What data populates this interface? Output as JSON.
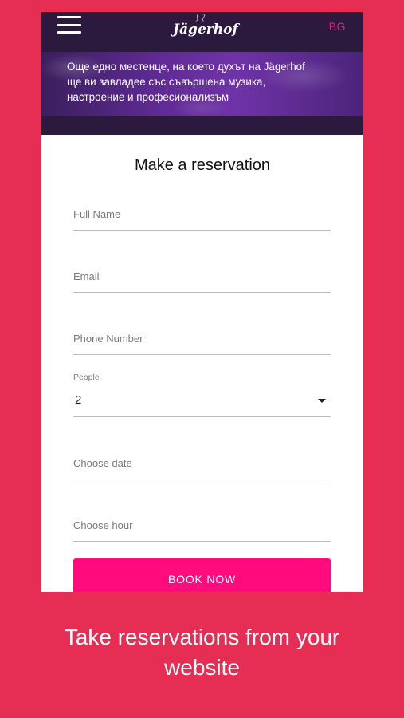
{
  "colors": {
    "background": "#e62e55",
    "header": "#2b1a3e",
    "accent": "#ff0b7e",
    "lang": "#e8227a"
  },
  "header": {
    "menu_icon": "hamburger-menu-icon",
    "logo_text": "Jägerhof",
    "lang": "BG"
  },
  "hero": {
    "lines": [
      "Още едно местенце, на което духът на Jägerhof",
      "ще ви завладее със съвършена музика,",
      "настроение и професионализъм"
    ]
  },
  "form": {
    "title": "Make a reservation",
    "full_name_placeholder": "Full Name",
    "email_placeholder": "Email",
    "phone_placeholder": "Phone Number",
    "people_label": "People",
    "people_value": "2",
    "date_placeholder": "Choose date",
    "hour_placeholder": "Choose hour",
    "submit_label": "BOOK NOW"
  },
  "caption": {
    "line1": "Take reservations from your",
    "line2": "website"
  }
}
